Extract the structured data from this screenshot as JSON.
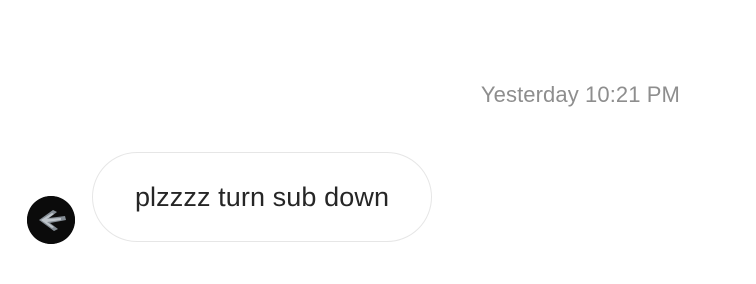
{
  "conversation": {
    "timestamp": "Yesterday 10:21 PM",
    "messages": [
      {
        "text": "plzzzz turn sub down",
        "avatar_icon": "user-avatar-dark-photo"
      }
    ]
  },
  "colors": {
    "timestamp_text": "#8e8e8e",
    "bubble_border": "#e6e6e6",
    "message_text": "#262626",
    "avatar_bg": "#0b0b0b"
  }
}
